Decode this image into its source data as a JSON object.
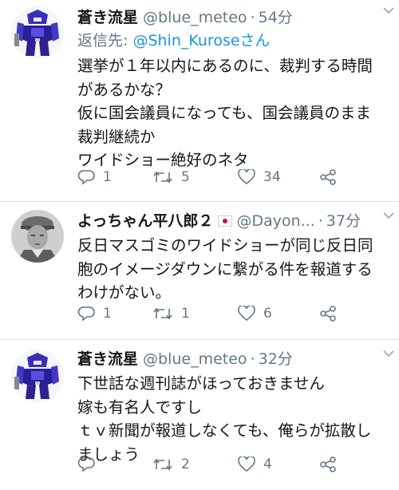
{
  "tweets": [
    {
      "name": "蒼き流星",
      "handle": "@blue_meteo",
      "separator": "·",
      "time": "54分",
      "reply_prefix": "返信先: ",
      "reply_user": "@Shin_Kurose",
      "reply_suffix": "さん",
      "text": "選挙が１年以内にあるのに、裁判する時間\nがあるかな？\n仮に国会議員になっても、国会議員のまま\n裁判継続か\nワイドショー絶好のネタ",
      "replies": "1",
      "retweets": "5",
      "likes": "34",
      "avatar_icon": "blue-robot-avatar"
    },
    {
      "name": "よっちゃん平八郎２",
      "handle": "@Dayon...",
      "separator": "·",
      "time": "37分",
      "text": "反日マスゴミのワイドショーが同じ反日同\n胞のイメージダウンに繋がる件を報道する\nわけがない。",
      "replies": "1",
      "retweets": "1",
      "likes": "6",
      "avatar_icon": "soldier-photo-avatar",
      "flag_icon": "japan-flag-icon"
    },
    {
      "name": "蒼き流星",
      "handle": "@blue_meteo",
      "separator": "·",
      "time": "32分",
      "text": "下世話な週刊誌がほっておきません\n嫁も有名人ですし\nｔｖ新聞が報道しなくても、俺らが拡散し\nましょう",
      "replies": "",
      "retweets": "2",
      "likes": "4",
      "avatar_icon": "blue-robot-avatar"
    }
  ],
  "colors": {
    "text": "#14171a",
    "secondary": "#657786",
    "link": "#1b95e0",
    "divider": "#e1e8ed"
  }
}
